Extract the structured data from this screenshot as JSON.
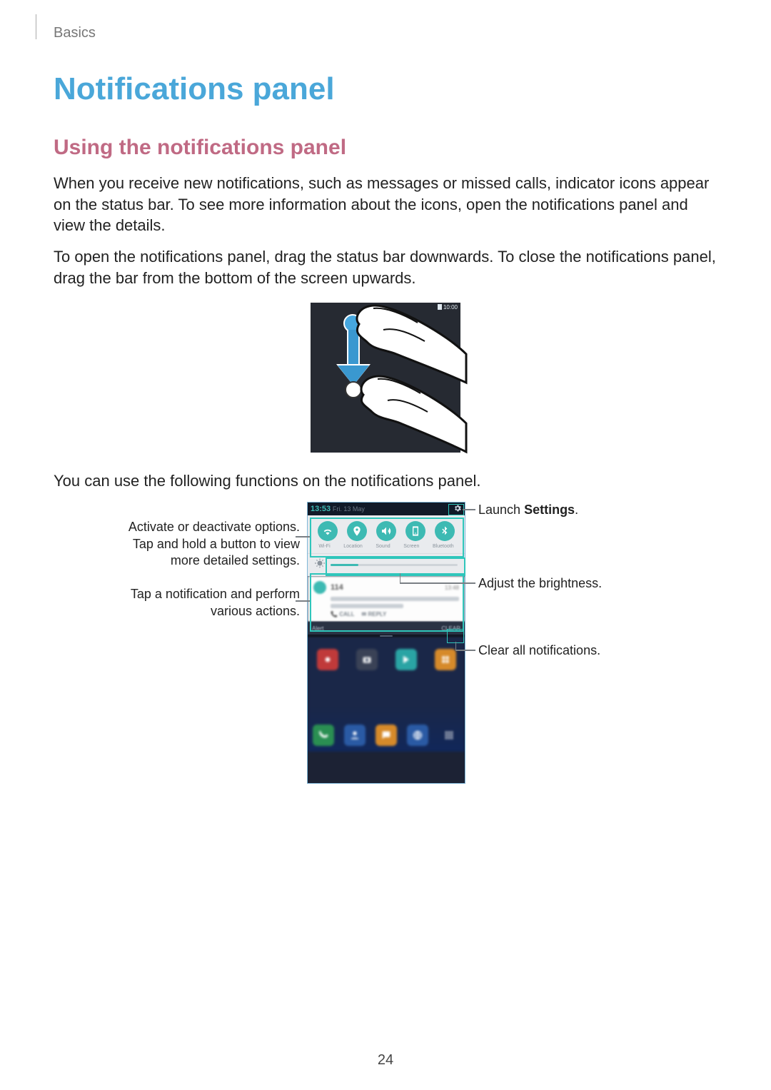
{
  "breadcrumb": "Basics",
  "title": "Notifications panel",
  "subtitle": "Using the notifications panel",
  "paragraphs": {
    "p1": "When you receive new notifications, such as messages or missed calls, indicator icons appear on the status bar. To see more information about the icons, open the notifications panel and view the details.",
    "p2": "To open the notifications panel, drag the status bar downwards. To close the notifications panel, drag the bar from the bottom of the screen upwards.",
    "p3": "You can use the following functions on the notifications panel."
  },
  "figure1": {
    "status_time": "10:00"
  },
  "figure2": {
    "status": {
      "time": "13:53",
      "date": "Fri. 13 May"
    },
    "quick_toggle_labels": [
      "Wi-Fi",
      "Location",
      "Sound",
      "Screen",
      "Bluetooth"
    ],
    "notification": {
      "title": "114",
      "time": "13:48",
      "action1": "CALL",
      "action2": "REPLY"
    },
    "clearbar": {
      "left": "Alert",
      "right": "CLEAR"
    }
  },
  "callouts": {
    "left1": "Activate or deactivate options. Tap and hold a button to view more detailed settings.",
    "left2": "Tap a notification and perform various actions.",
    "right1_pre": "Launch ",
    "right1_bold": "Settings",
    "right1_post": ".",
    "right2": "Adjust the brightness.",
    "right3": "Clear all notifications."
  },
  "page_number": "24"
}
